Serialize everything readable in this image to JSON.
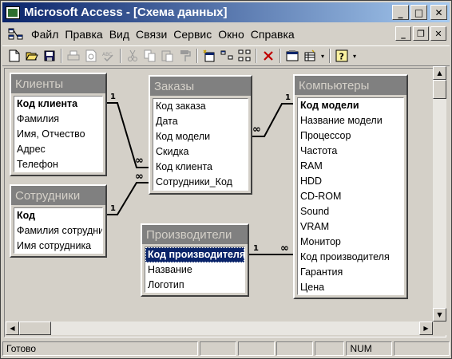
{
  "window": {
    "title": "Microsoft Access - [Схема данных]",
    "controls": {
      "minimize": "_",
      "maximize": "□",
      "close": "✕"
    }
  },
  "menubar": {
    "items": [
      {
        "label": "Файл",
        "icon": ""
      },
      {
        "label": "Правка"
      },
      {
        "label": "Вид"
      },
      {
        "label": "Связи"
      },
      {
        "label": "Сервис"
      },
      {
        "label": "Окно"
      },
      {
        "label": "Справка"
      }
    ],
    "doc_controls": {
      "minimize": "_",
      "restore": "❐",
      "close": "✕"
    }
  },
  "toolbar": {
    "icons": [
      "new-icon",
      "open-icon",
      "save-icon",
      "print-icon",
      "print-preview-icon",
      "spelling-icon",
      "cut-icon",
      "copy-icon",
      "paste-icon",
      "format-painter-icon",
      "show-table-icon",
      "show-direct-icon",
      "show-all-icon",
      "delete-icon",
      "database-window-icon",
      "new-object-icon",
      "help-icon"
    ]
  },
  "tables": {
    "clients": {
      "title": "Клиенты",
      "fields": [
        "Код клиента",
        "Фамилия",
        "Имя, Отчество",
        "Адрес",
        "Телефон"
      ]
    },
    "employees": {
      "title": "Сотрудники",
      "fields": [
        "Код",
        "Фамилия сотрудни",
        "Имя сотрудника"
      ]
    },
    "orders": {
      "title": "Заказы",
      "fields": [
        "Код заказа",
        "Дата",
        "Код модели",
        "Скидка",
        "Код клиента",
        "Сотрудники_Код"
      ]
    },
    "manufacturers": {
      "title": "Производители",
      "fields": [
        "Код производителя",
        "Название",
        "Логотип"
      ]
    },
    "computers": {
      "title": "Компьютеры",
      "fields": [
        "Код модели",
        "Название модели",
        "Процессор",
        "Частота",
        "RAM",
        "HDD",
        "CD-ROM",
        "Sound",
        "VRAM",
        "Монитор",
        "Код производителя",
        "Гарантия",
        "Цена"
      ]
    }
  },
  "relationships": {
    "one": "1",
    "many": "∞"
  },
  "statusbar": {
    "status": "Готово",
    "num": "NUM"
  }
}
